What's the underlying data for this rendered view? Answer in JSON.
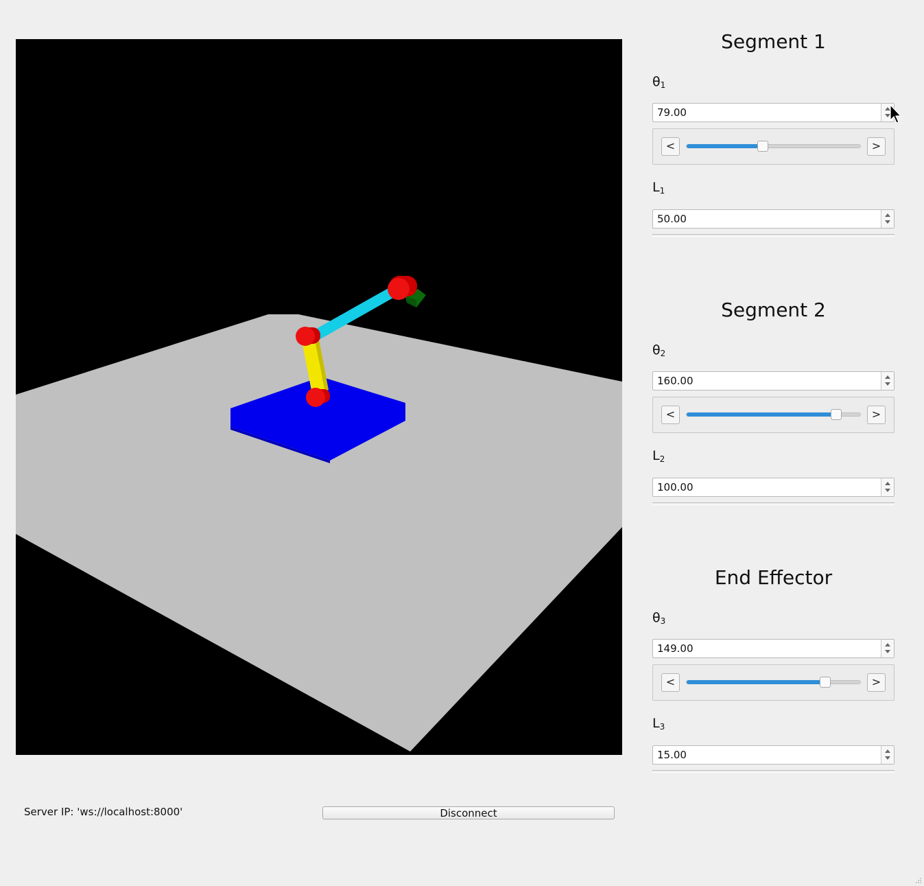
{
  "segments": [
    {
      "title": "Segment 1",
      "theta": {
        "symbol": "θ",
        "index": "1",
        "value": "79.00",
        "fraction": 0.44
      },
      "length": {
        "symbol": "L",
        "index": "1",
        "value": "50.00"
      }
    },
    {
      "title": "Segment 2",
      "theta": {
        "symbol": "θ",
        "index": "2",
        "value": "160.00",
        "fraction": 0.86
      },
      "length": {
        "symbol": "L",
        "index": "2",
        "value": "100.00"
      }
    },
    {
      "title": "End Effector",
      "theta": {
        "symbol": "θ",
        "index": "3",
        "value": "149.00",
        "fraction": 0.8
      },
      "length": {
        "symbol": "L",
        "index": "3",
        "value": "15.00"
      }
    }
  ],
  "stepper": {
    "decrement": "<",
    "increment": ">"
  },
  "footer": {
    "server_label": "Server IP: 'ws://localhost:8000'",
    "disconnect_label": "Disconnect"
  },
  "colors": {
    "viewport_background": "#000000",
    "floor": "#c0c0c0",
    "base": "#0000ee",
    "joint": "#ee1111",
    "segment_1": "#f2e600",
    "segment_2": "#14cde6",
    "end_effector": "#0b6b0b",
    "slider_fill": "#2f8ed8"
  }
}
